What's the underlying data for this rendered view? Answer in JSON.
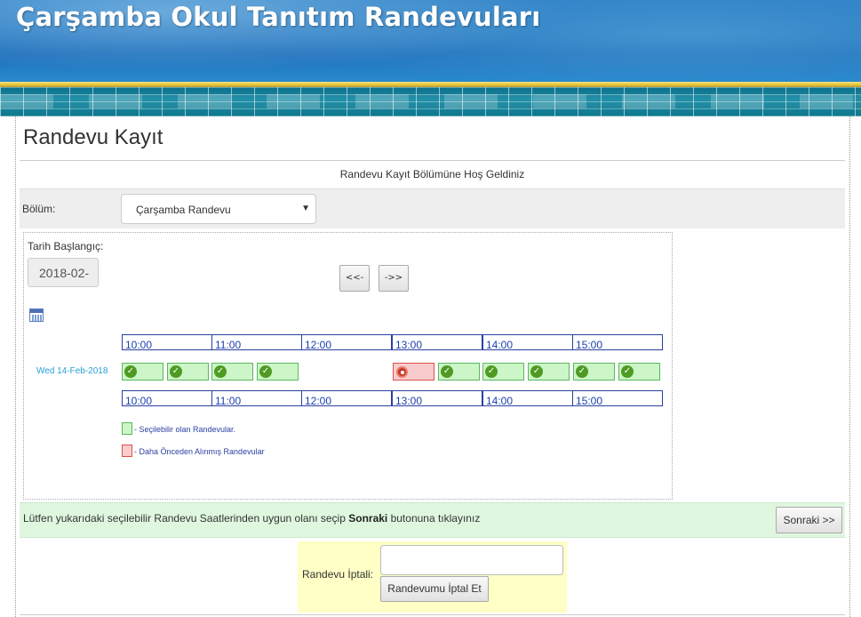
{
  "header": {
    "title": "Çarşamba Okul Tanıtım Randevuları"
  },
  "page": {
    "title": "Randevu Kayıt",
    "welcome": "Randevu Kayıt Bölümüne Hoş Geldiniz"
  },
  "section": {
    "label": "Bölüm:",
    "selected": "Çarşamba Randevu"
  },
  "calendar": {
    "start_label": "Tarih Başlangıç:",
    "start_value": "2018-02-",
    "prev_label": "<<-",
    "next_label": "->>",
    "day_label": "Wed 14-Feb-2018",
    "hours": [
      "10:00",
      "11:00",
      "12:00",
      "13:00",
      "14:00",
      "15:00"
    ],
    "slots": [
      {
        "status": "available"
      },
      {
        "status": "available"
      },
      {
        "status": "available"
      },
      {
        "status": "available"
      },
      {
        "status": "taken"
      },
      {
        "status": "available"
      },
      {
        "status": "available"
      },
      {
        "status": "available"
      },
      {
        "status": "available"
      },
      {
        "status": "available"
      }
    ]
  },
  "legend": {
    "available": "- Seçilebilir olan Randevular.",
    "taken": "- Daha Önceden Alınmış Randevular"
  },
  "instruction": {
    "before": "Lütfen yukarıdaki seçilebilir Randevu Saatlerinden uygun olanı seçip ",
    "bold": "Sonraki",
    "after": " butonuna tıklayınız",
    "next_button": "Sonraki >>"
  },
  "cancel": {
    "label": "Randevu İptali:",
    "input_value": "",
    "button": "Randevumu İptal Et"
  },
  "colors": {
    "available_fill": "#ccf5c8",
    "available_border": "#5cb85c",
    "taken_fill": "#f8cccc",
    "taken_border": "#d9534f",
    "instruction_bg": "#dff7df",
    "cancel_bg": "#ffffc6"
  }
}
